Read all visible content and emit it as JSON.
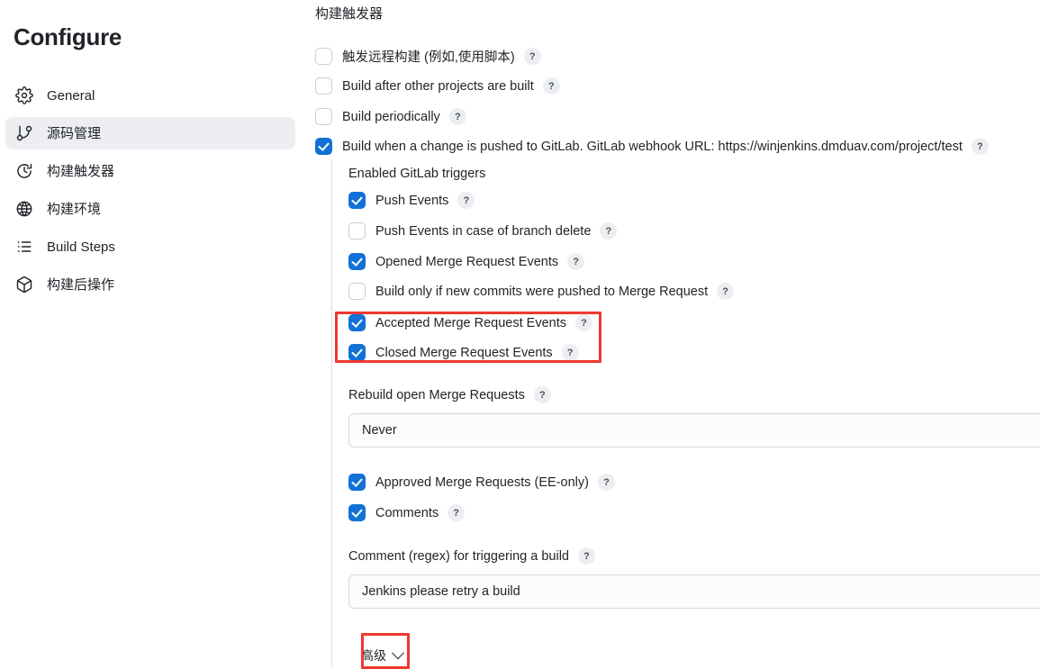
{
  "sidebar": {
    "title": "Configure",
    "items": [
      {
        "label": "General",
        "icon": "gear-icon",
        "active": false
      },
      {
        "label": "源码管理",
        "icon": "git-branch-icon",
        "active": true
      },
      {
        "label": "构建触发器",
        "icon": "clock-icon",
        "active": false
      },
      {
        "label": "构建环境",
        "icon": "globe-icon",
        "active": false
      },
      {
        "label": "Build Steps",
        "icon": "list-icon",
        "active": false
      },
      {
        "label": "构建后操作",
        "icon": "package-icon",
        "active": false
      }
    ]
  },
  "main": {
    "section_title": "构建触发器",
    "triggers": [
      {
        "label": "触发远程构建 (例如,使用脚本)",
        "checked": false,
        "help": "?"
      },
      {
        "label": "Build after other projects are built",
        "checked": false,
        "help": "?"
      },
      {
        "label": "Build periodically",
        "checked": false,
        "help": "?"
      },
      {
        "label": "Build when a change is pushed to GitLab. GitLab webhook URL: https://winjenkins.dmduav.com/project/test",
        "checked": true,
        "help": "?"
      }
    ],
    "enabled_triggers_label": "Enabled GitLab triggers",
    "gitlab_triggers": [
      {
        "label": "Push Events",
        "checked": true,
        "help": "?"
      },
      {
        "label": "Push Events in case of branch delete",
        "checked": false,
        "help": "?"
      },
      {
        "label": "Opened Merge Request Events",
        "checked": true,
        "help": "?"
      },
      {
        "label": "Build only if new commits were pushed to Merge Request",
        "checked": false,
        "help": "?"
      },
      {
        "label": "Accepted Merge Request Events",
        "checked": true,
        "help": "?"
      },
      {
        "label": "Closed Merge Request Events",
        "checked": true,
        "help": "?"
      }
    ],
    "rebuild": {
      "label": "Rebuild open Merge Requests",
      "help": "?",
      "value": "Never"
    },
    "approvals": [
      {
        "label": "Approved Merge Requests (EE-only)",
        "checked": true,
        "help": "?"
      },
      {
        "label": "Comments",
        "checked": true,
        "help": "?"
      }
    ],
    "comment_regex": {
      "label": "Comment (regex) for triggering a build",
      "help": "?",
      "value": "Jenkins please retry a build"
    },
    "advanced_button": {
      "label": "高级",
      "icon": "chevron-down-icon"
    }
  },
  "annotations": {
    "highlight_color": "#f0382f"
  }
}
